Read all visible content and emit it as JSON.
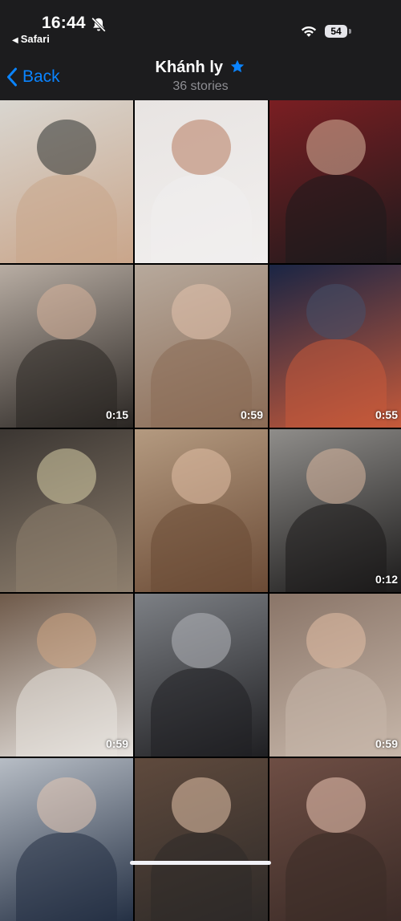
{
  "status": {
    "time": "16:44",
    "back_app": "Safari",
    "battery": "54"
  },
  "nav": {
    "back_label": "Back",
    "title": "Khánh ly",
    "subtitle": "36 stories",
    "accent": "#0a84ff"
  },
  "stories": [
    {
      "duration": "",
      "colors": [
        "#d9d6d0",
        "#2c2f2e",
        "#c9a58a"
      ]
    },
    {
      "duration": "",
      "colors": [
        "#e8e4e2",
        "#b77a5e",
        "#f1efee"
      ]
    },
    {
      "duration": "",
      "colors": [
        "#7a1e22",
        "#d9b49c",
        "#1e1a1c"
      ]
    },
    {
      "duration": "0:15",
      "colors": [
        "#b8ada3",
        "#d7b39a",
        "#2a2623"
      ]
    },
    {
      "duration": "0:59",
      "colors": [
        "#b7a99c",
        "#e4c3ad",
        "#8a6b55"
      ]
    },
    {
      "duration": "0:55",
      "colors": [
        "#1a2544",
        "#46506a",
        "#c75a3a"
      ]
    },
    {
      "duration": "",
      "colors": [
        "#3b3632",
        "#d9cfa8",
        "#8e7f6e"
      ]
    },
    {
      "duration": "",
      "colors": [
        "#b49a80",
        "#e2bfa5",
        "#6a4a35"
      ]
    },
    {
      "duration": "0:12",
      "colors": [
        "#8f8d8a",
        "#d9b79e",
        "#1b1a1a"
      ]
    },
    {
      "duration": "0:59",
      "colors": [
        "#6f5a4a",
        "#d0a584",
        "#e7e3df"
      ]
    },
    {
      "duration": "",
      "colors": [
        "#7d8085",
        "#b4b7bc",
        "#1f1f22"
      ]
    },
    {
      "duration": "0:59",
      "colors": [
        "#8a7568",
        "#e4c0a6",
        "#c7b7aa"
      ]
    },
    {
      "duration": "",
      "colors": [
        "#b7bdc5",
        "#e6c9b4",
        "#243044"
      ]
    },
    {
      "duration": "",
      "colors": [
        "#5f4a3d",
        "#e3c3aa",
        "#2e2a28"
      ]
    },
    {
      "duration": "",
      "colors": [
        "#6e4e44",
        "#efc9b6",
        "#3b2b27"
      ]
    }
  ]
}
